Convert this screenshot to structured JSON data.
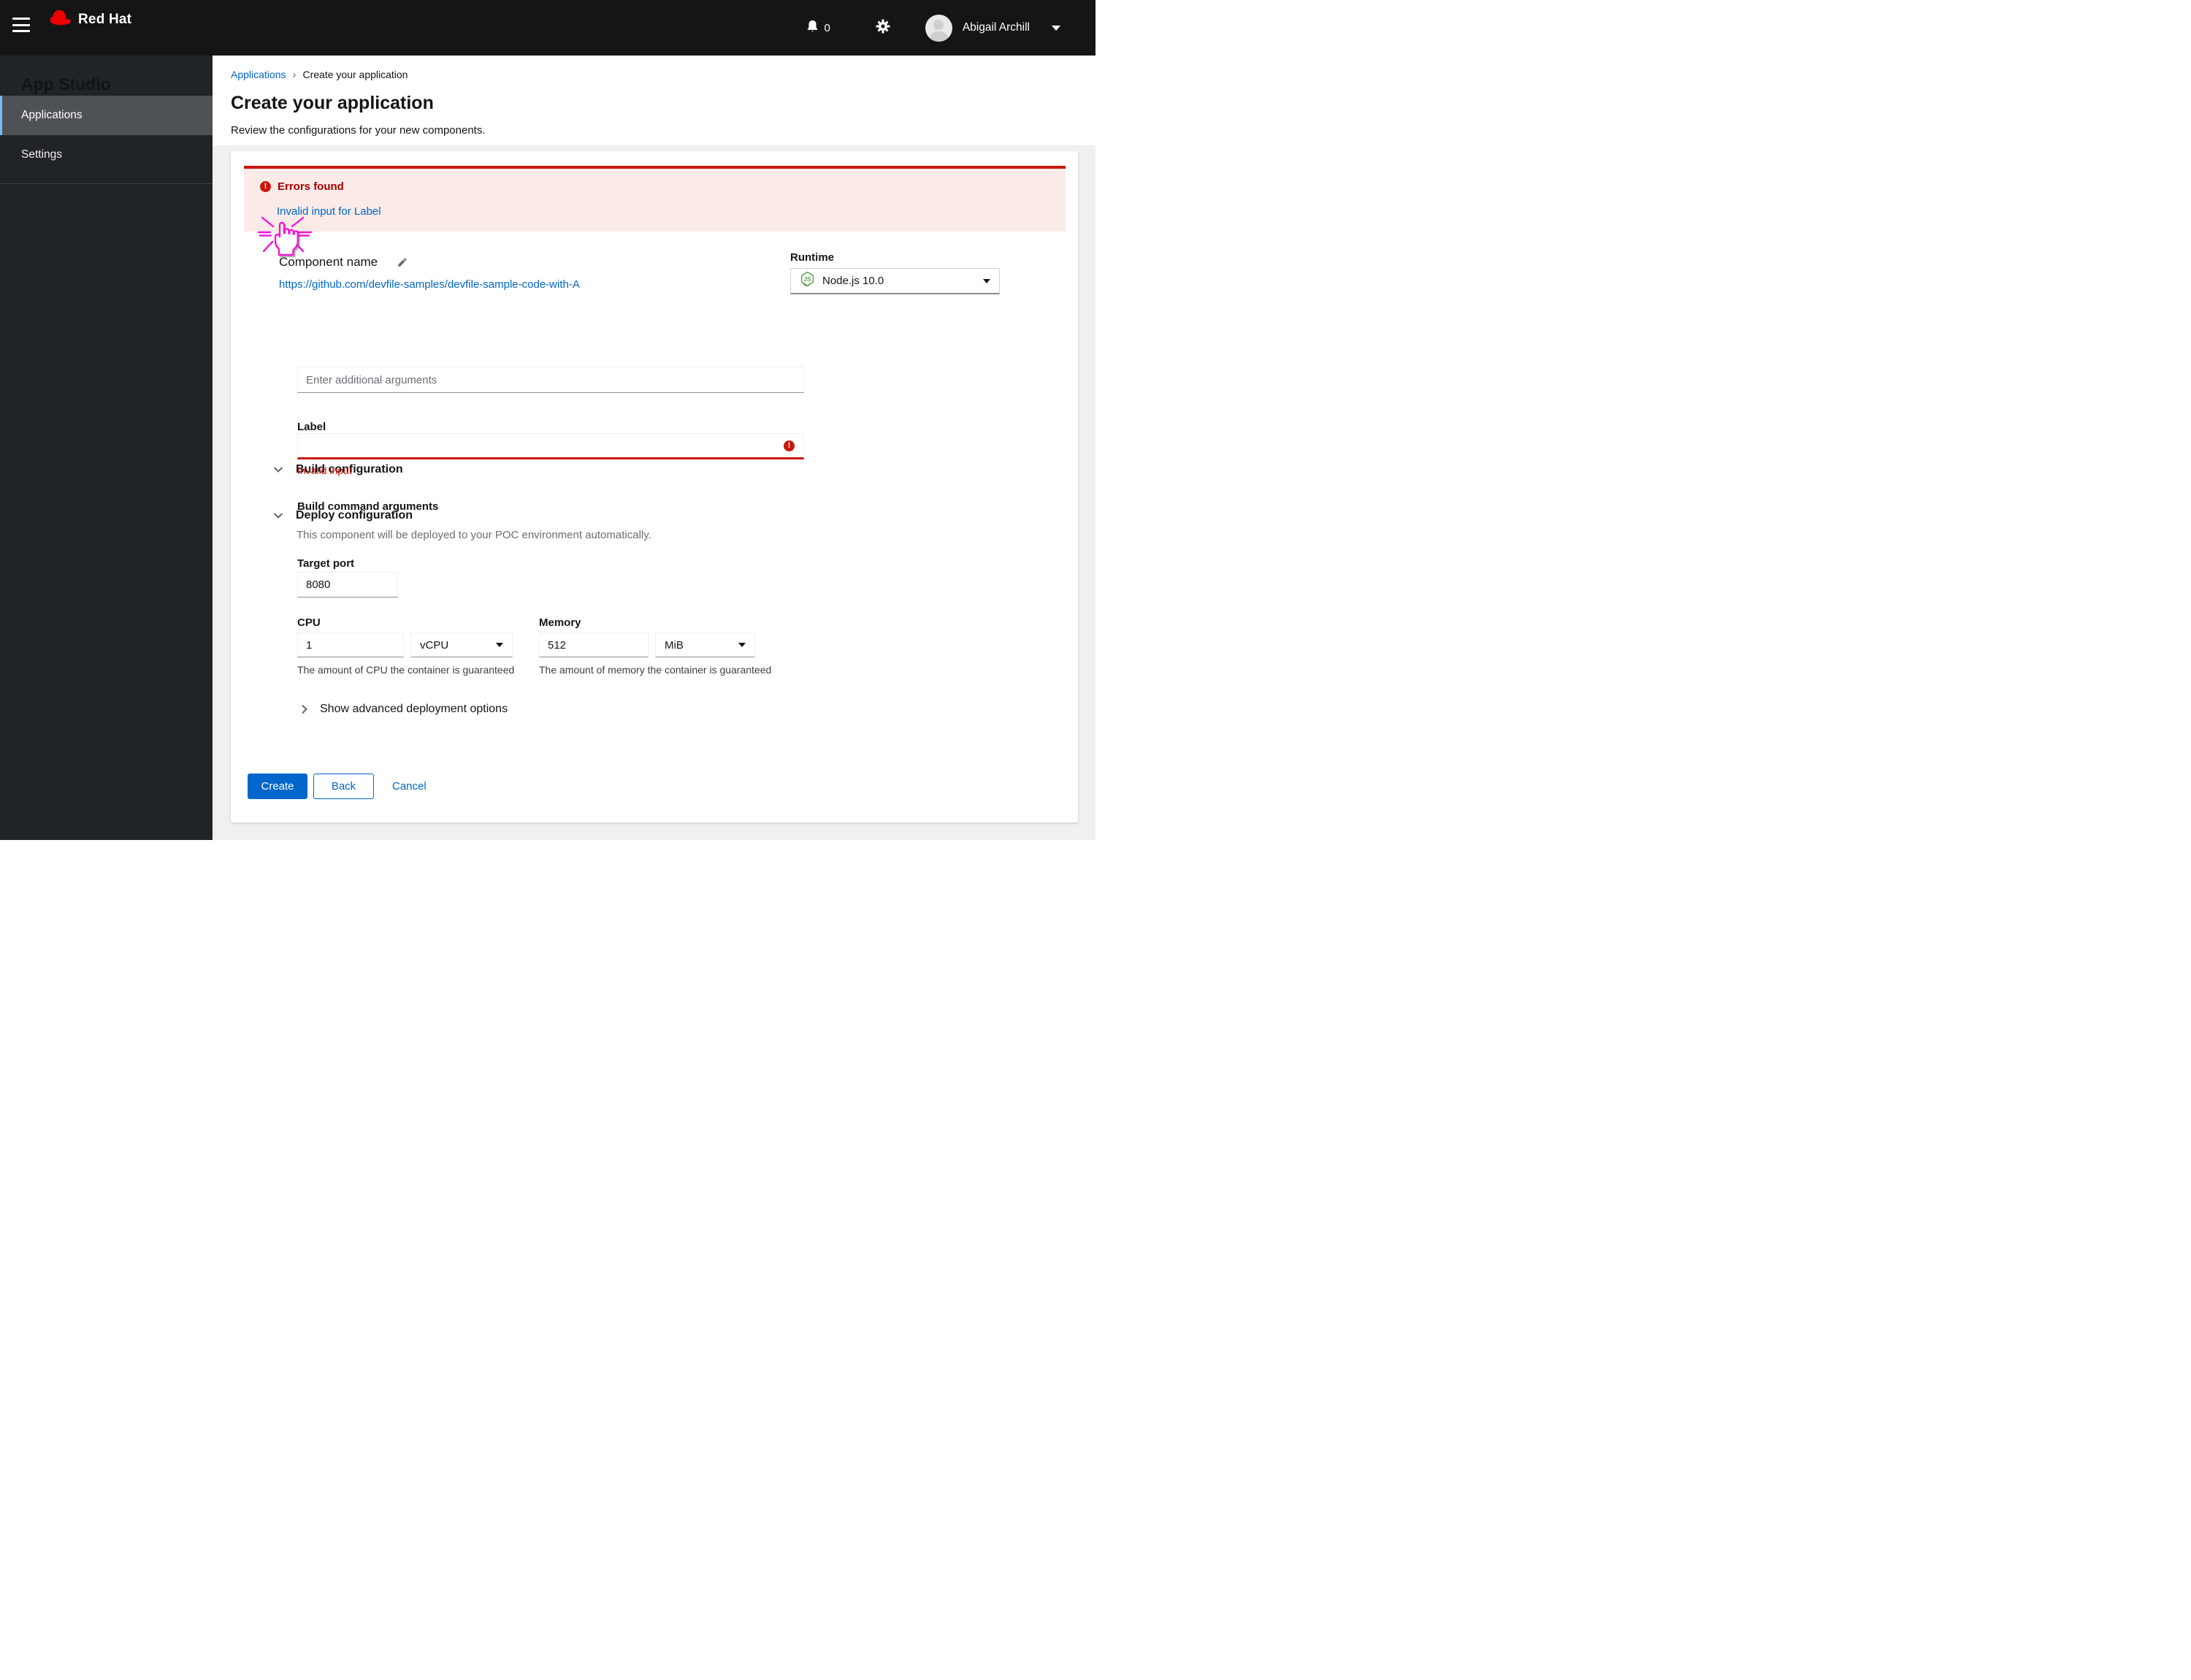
{
  "header": {
    "brand": "Red Hat",
    "notification_count": "0",
    "user_name": "Abigail Archill"
  },
  "sidebar": {
    "title": "App Studio",
    "items": [
      {
        "label": "Applications",
        "selected": true
      },
      {
        "label": "Settings",
        "selected": false
      }
    ]
  },
  "breadcrumb": {
    "items": [
      "Applications",
      "Create your application"
    ]
  },
  "page": {
    "title": "Create your application",
    "subtitle": "Review the configurations for your new components."
  },
  "alert": {
    "title": "Errors found",
    "link": "Invalid input for Label"
  },
  "component": {
    "name_label": "Component name",
    "repo_link": "https://github.com/devfile-samples/devfile-sample-code-with-A",
    "runtime_label": "Runtime",
    "runtime_value": "Node.js 10.0"
  },
  "build": {
    "section_title": "Build configuration",
    "args_label": "Build command arguments",
    "args_placeholder": "Enter additional arguments",
    "label_label": "Label",
    "label_value": "",
    "label_error": "Invalid input"
  },
  "deploy": {
    "section_title": "Deploy configuration",
    "description": "This component will be deployed to your POC environment automatically.",
    "target_port_label": "Target port",
    "target_port_value": "8080",
    "cpu_label": "CPU",
    "cpu_value": "1",
    "cpu_unit": "vCPU",
    "cpu_help": "The amount of CPU the container is guaranteed",
    "memory_label": "Memory",
    "memory_value": "512",
    "memory_unit": "MiB",
    "memory_help": "The amount of memory the container is guaranteed",
    "advanced_toggle": "Show advanced deployment options"
  },
  "actions": {
    "create_label": "Create",
    "back_label": "Back",
    "cancel_label": "Cancel"
  },
  "colors": {
    "accent_blue": "#0066cc",
    "danger_red": "#c9190b",
    "alert_bg": "#faeae8",
    "alert_title": "#a30000",
    "nav_selected_accent": "#73bcf7",
    "header_bg": "#151515",
    "sidebar_bg": "#212427",
    "node_green": "#5ba352",
    "click_indicator": "#f217d6"
  }
}
